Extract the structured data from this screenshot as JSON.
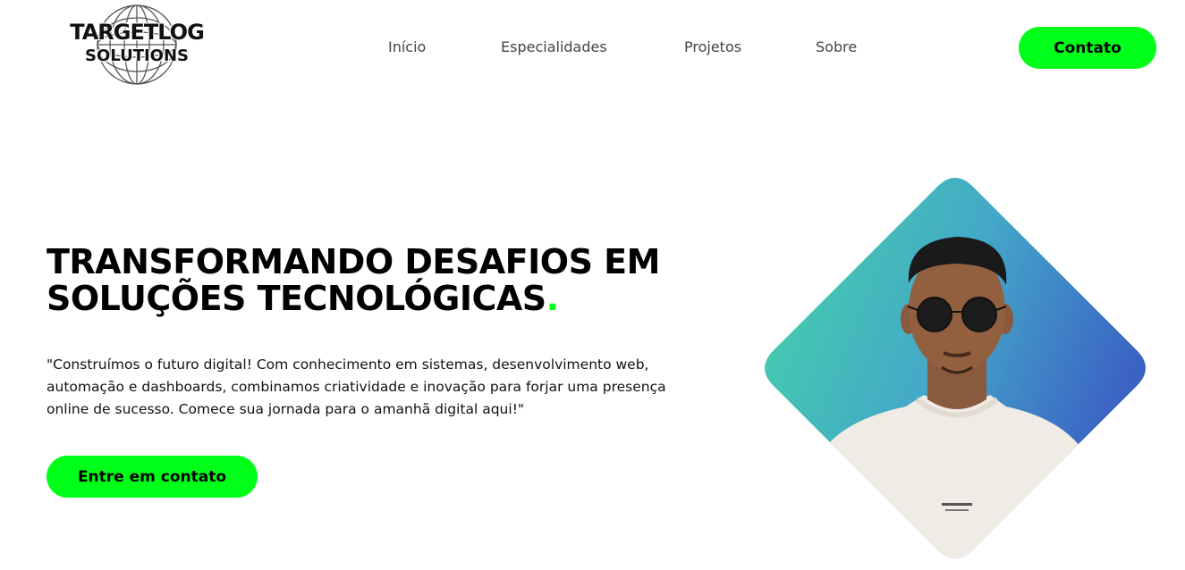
{
  "header": {
    "logo_line1": "TARGETLOG",
    "logo_line2": "SOLUTIONS",
    "nav": [
      "Início",
      "Especialidades",
      "Projetos",
      "Sobre"
    ],
    "contact_label": "Contato"
  },
  "hero": {
    "title": "TRANSFORMANDO DESAFIOS EM SOLUÇÕES TECNOLÓGICAS",
    "title_dot": ".",
    "description": "\"Construímos o futuro digital! Com conhecimento em sistemas, desenvolvimento web, automação e dashboards, combinamos criatividade e inovação para forjar uma presença online de sucesso. Comece sua jornada para o amanhã digital aqui!\"",
    "cta_label": "Entre em contato"
  },
  "colors": {
    "accent": "#00ff19",
    "gradient_start": "#45d6a6",
    "gradient_end": "#3b63c4"
  },
  "icons": {
    "logo": "globe-icon"
  }
}
